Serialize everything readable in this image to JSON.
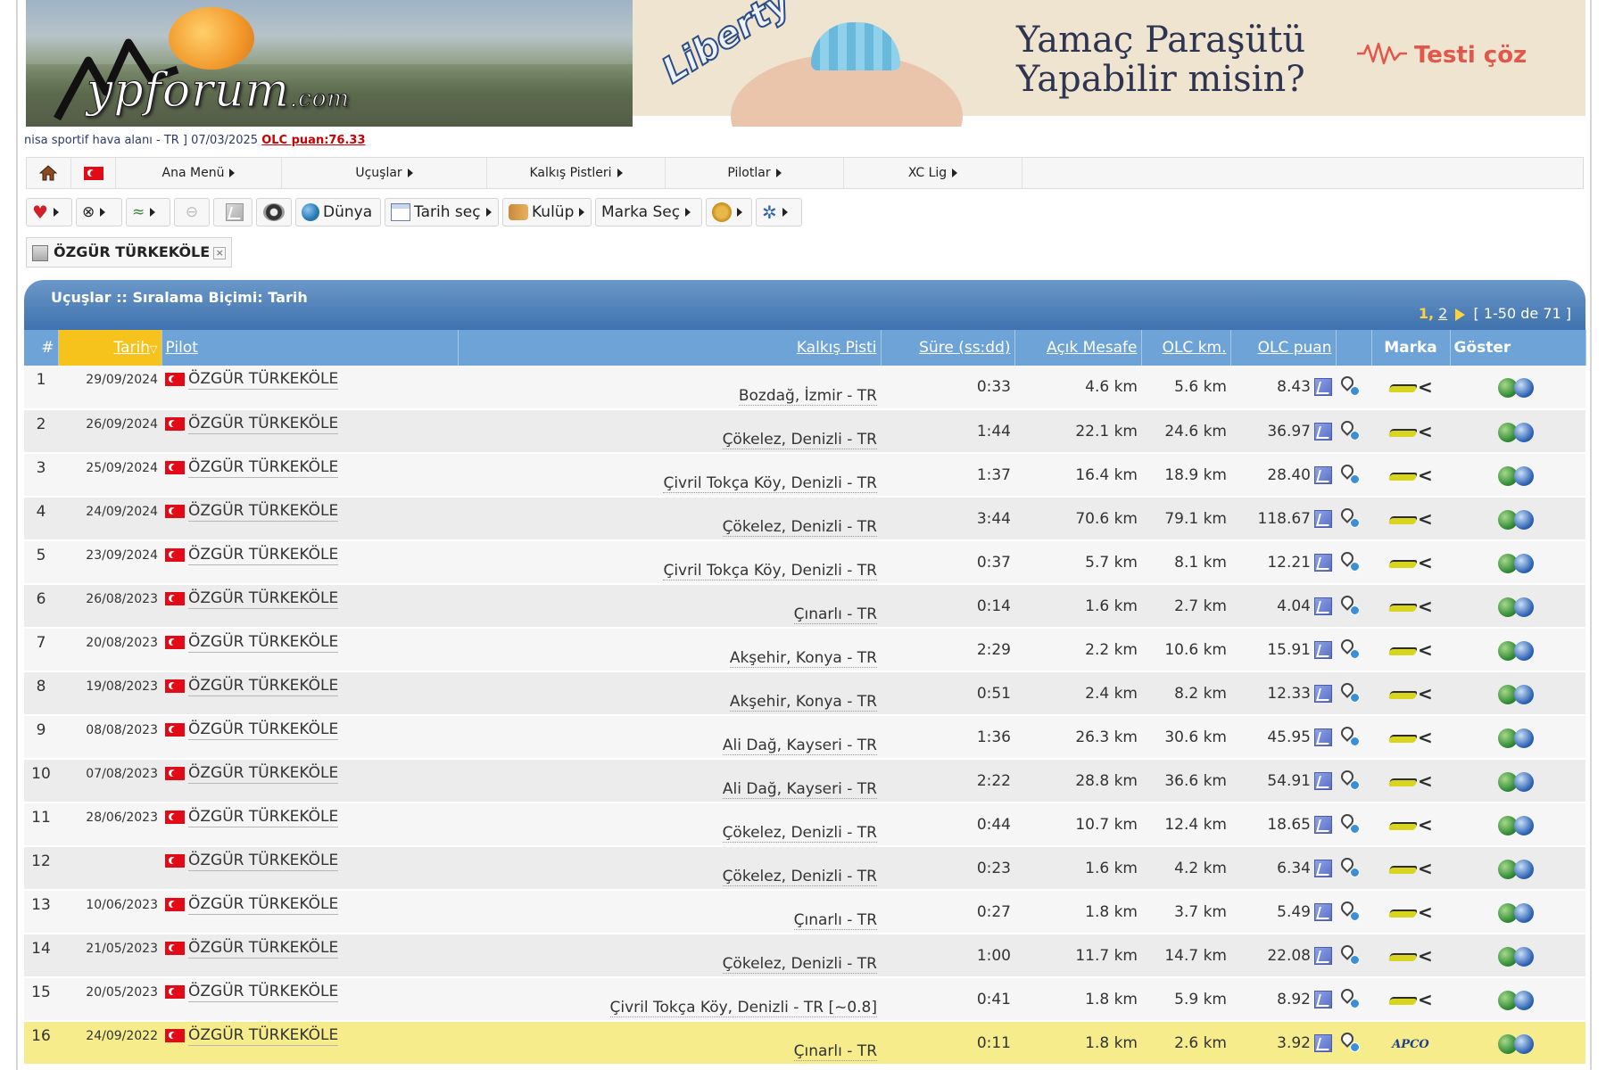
{
  "site": {
    "logo_text": "ypforum",
    "logo_suffix": ".com"
  },
  "ad": {
    "brand": "Liberty",
    "title_line1": "Yamaç Paraşütü",
    "title_line2": "Yapabilir misin?",
    "cta": "Testi çöz"
  },
  "status": {
    "prefix": "nisa sportif hava alanı - TR ] 07/03/2025",
    "olc": "OLC puan:76.33"
  },
  "menu": {
    "items": [
      "Ana Menü",
      "Uçuşlar",
      "Kalkış Pistleri",
      "Pilotlar",
      "XC Lig"
    ]
  },
  "toolbar": {
    "world": "Dünya",
    "date": "Tarih seç",
    "club": "Kulüp",
    "brand": "Marka Seç"
  },
  "filter": {
    "pilot": "ÖZGÜR TÜRKEKÖLE",
    "close": "×"
  },
  "panel": {
    "title": "Uçuşlar :: Sıralama Biçimi: Tarih",
    "page1": "1",
    "page_sep": ",",
    "page2": "2",
    "range": "[ 1-50 de 71 ]"
  },
  "columns": {
    "num": "#",
    "date": "Tarih",
    "pilot": "Pilot",
    "takeoff": "Kalkış Pisti",
    "duration": "Süre (ss:dd)",
    "open_distance": "Açık Mesafe",
    "olc_km": "OLC km.",
    "olc_points": "OLC puan",
    "brand": "Marka",
    "show": "Göster"
  },
  "flights": [
    {
      "num": "1",
      "date": "29/09/2024",
      "pilot": "ÖZGÜR TÜRKEKÖLE",
      "takeoff": "Bozdağ, İzmir - TR",
      "duration": "0:33",
      "open": "4.6 km",
      "olc_km": "5.6 km",
      "olc_pts": "8.43",
      "brand": "gin"
    },
    {
      "num": "2",
      "date": "26/09/2024",
      "pilot": "ÖZGÜR TÜRKEKÖLE",
      "takeoff": "Çökelez, Denizli - TR",
      "duration": "1:44",
      "open": "22.1 km",
      "olc_km": "24.6 km",
      "olc_pts": "36.97",
      "brand": "gin"
    },
    {
      "num": "3",
      "date": "25/09/2024",
      "pilot": "ÖZGÜR TÜRKEKÖLE",
      "takeoff": "Çivril Tokça Köy, Denizli - TR",
      "duration": "1:37",
      "open": "16.4 km",
      "olc_km": "18.9 km",
      "olc_pts": "28.40",
      "brand": "gin"
    },
    {
      "num": "4",
      "date": "24/09/2024",
      "pilot": "ÖZGÜR TÜRKEKÖLE",
      "takeoff": "Çökelez, Denizli - TR",
      "duration": "3:44",
      "open": "70.6 km",
      "olc_km": "79.1 km",
      "olc_pts": "118.67",
      "brand": "gin"
    },
    {
      "num": "5",
      "date": "23/09/2024",
      "pilot": "ÖZGÜR TÜRKEKÖLE",
      "takeoff": "Çivril Tokça Köy, Denizli - TR",
      "duration": "0:37",
      "open": "5.7 km",
      "olc_km": "8.1 km",
      "olc_pts": "12.21",
      "brand": "gin"
    },
    {
      "num": "6",
      "date": "26/08/2023",
      "pilot": "ÖZGÜR TÜRKEKÖLE",
      "takeoff": "Çınarlı - TR",
      "duration": "0:14",
      "open": "1.6 km",
      "olc_km": "2.7 km",
      "olc_pts": "4.04",
      "brand": "gin"
    },
    {
      "num": "7",
      "date": "20/08/2023",
      "pilot": "ÖZGÜR TÜRKEKÖLE",
      "takeoff": "Akşehir, Konya - TR",
      "duration": "2:29",
      "open": "2.2 km",
      "olc_km": "10.6 km",
      "olc_pts": "15.91",
      "brand": "gin"
    },
    {
      "num": "8",
      "date": "19/08/2023",
      "pilot": "ÖZGÜR TÜRKEKÖLE",
      "takeoff": "Akşehir, Konya - TR",
      "duration": "0:51",
      "open": "2.4 km",
      "olc_km": "8.2 km",
      "olc_pts": "12.33",
      "brand": "gin"
    },
    {
      "num": "9",
      "date": "08/08/2023",
      "pilot": "ÖZGÜR TÜRKEKÖLE",
      "takeoff": "Ali Dağ, Kayseri - TR",
      "duration": "1:36",
      "open": "26.3 km",
      "olc_km": "30.6 km",
      "olc_pts": "45.95",
      "brand": "gin"
    },
    {
      "num": "10",
      "date": "07/08/2023",
      "pilot": "ÖZGÜR TÜRKEKÖLE",
      "takeoff": "Ali Dağ, Kayseri - TR",
      "duration": "2:22",
      "open": "28.8 km",
      "olc_km": "36.6 km",
      "olc_pts": "54.91",
      "brand": "gin"
    },
    {
      "num": "11",
      "date": "28/06/2023",
      "pilot": "ÖZGÜR TÜRKEKÖLE",
      "takeoff": "Çökelez, Denizli - TR",
      "duration": "0:44",
      "open": "10.7 km",
      "olc_km": "12.4 km",
      "olc_pts": "18.65",
      "brand": "gin"
    },
    {
      "num": "12",
      "date": "",
      "pilot": "ÖZGÜR TÜRKEKÖLE",
      "takeoff": "Çökelez, Denizli - TR",
      "duration": "0:23",
      "open": "1.6 km",
      "olc_km": "4.2 km",
      "olc_pts": "6.34",
      "brand": "gin"
    },
    {
      "num": "13",
      "date": "10/06/2023",
      "pilot": "ÖZGÜR TÜRKEKÖLE",
      "takeoff": "Çınarlı - TR",
      "duration": "0:27",
      "open": "1.8 km",
      "olc_km": "3.7 km",
      "olc_pts": "5.49",
      "brand": "gin"
    },
    {
      "num": "14",
      "date": "21/05/2023",
      "pilot": "ÖZGÜR TÜRKEKÖLE",
      "takeoff": "Çökelez, Denizli - TR",
      "duration": "1:00",
      "open": "11.7 km",
      "olc_km": "14.7 km",
      "olc_pts": "22.08",
      "brand": "gin"
    },
    {
      "num": "15",
      "date": "20/05/2023",
      "pilot": "ÖZGÜR TÜRKEKÖLE",
      "takeoff": "Çivril Tokça Köy, Denizli - TR [~0.8]",
      "duration": "0:41",
      "open": "1.8 km",
      "olc_km": "5.9 km",
      "olc_pts": "8.92",
      "brand": "gin"
    },
    {
      "num": "16",
      "date": "24/09/2022",
      "pilot": "ÖZGÜR TÜRKEKÖLE",
      "takeoff": "Çınarlı - TR",
      "duration": "0:11",
      "open": "1.8 km",
      "olc_km": "2.6 km",
      "olc_pts": "3.92",
      "brand": "apco",
      "highlight": true
    }
  ],
  "brand_apco_label": "APCO",
  "colors": {
    "header_blue": "#6ea3d7",
    "panel_blue": "#3f72ae",
    "sorted_col": "#f6c21c",
    "highlight_row": "#f6ec8c",
    "olc_link": "#cc0000"
  }
}
